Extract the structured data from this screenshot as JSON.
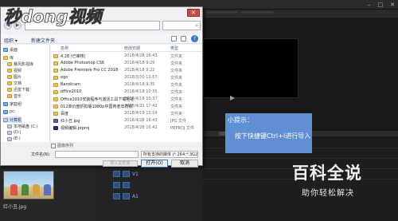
{
  "watermark_left": {
    "text": "秒dong视频"
  },
  "watermark_right": {
    "title": "百科全说",
    "subtitle": "助你轻松解决"
  },
  "tooltip": {
    "title": "小提示：",
    "text": "按下快捷键Ctrl+I进行导入"
  },
  "dialog": {
    "toolbar": {
      "organize": "组织 ▾",
      "new_folder": "新建文件夹",
      "help": "?"
    },
    "close": "✕",
    "nav": [
      {
        "label": "桌面"
      },
      {
        "label": "库"
      },
      {
        "label": "暴风影视库"
      },
      {
        "label": "视频"
      },
      {
        "label": "图片"
      },
      {
        "label": "文档"
      },
      {
        "label": "迅雷下载"
      },
      {
        "label": "音乐"
      },
      {
        "label": "家庭组"
      },
      {
        "label": "pc"
      },
      {
        "label": "计算机"
      },
      {
        "label": "本地磁盘 (C:)"
      },
      {
        "label": "(D:)"
      },
      {
        "label": "(E:)"
      }
    ],
    "columns": {
      "name": "名称",
      "date": "修改日期",
      "type": "类型"
    },
    "files": [
      {
        "name": "4.28 (已审核)",
        "date": "2018/4/28 16:43",
        "type": "文件夹",
        "icon": "folder-icon"
      },
      {
        "name": "Adobe Photoshop CS6",
        "date": "2018/4/18 9:29",
        "type": "文件夹",
        "icon": "folder-icon"
      },
      {
        "name": "Adobe Premiere Pro CC 2018",
        "date": "2018/4/18 9:22",
        "type": "文件夹",
        "icon": "folder-icon"
      },
      {
        "name": "ego",
        "date": "2018/3/30 13:57",
        "type": "文件夹",
        "icon": "folder-icon"
      },
      {
        "name": "Bandicam",
        "date": "2018/4/18 9:35",
        "type": "文件夹",
        "icon": "folder-icon"
      },
      {
        "name": "office2010",
        "date": "2018/4/18 10:35",
        "type": "文件夹",
        "icon": "folder-icon"
      },
      {
        "name": "Office2010安装程序与激活工具下载地址",
        "date": "2018/4/18 10:37",
        "type": "文件夹",
        "icon": "folder-icon"
      },
      {
        "name": "012单价盘折扣版1080p中国男老年奇航",
        "date": "2018/4/21 17:42",
        "type": "文件夹",
        "icon": "folder-icon"
      },
      {
        "name": "百度",
        "date": "2018/4/19 15:54",
        "type": "文件夹",
        "icon": "folder-icon"
      },
      {
        "name": "红小丑.jpg",
        "date": "2018/4/28 16:43",
        "type": "JPG 文件",
        "icon": "video-file-icon"
      },
      {
        "name": "视频编辑.prproj",
        "date": "2018/4/28 16:42",
        "type": "PRPROJ 文件",
        "icon": "project-file-icon"
      }
    ],
    "sequence_checkbox": "图像序列",
    "filename_label": "文件名(N):",
    "filename_value": "",
    "filetype_value": "所有支持的媒体 (*.264;*.3G2;*",
    "import_folder_button": "导入文件夹",
    "open_button": "打开(O)",
    "cancel_button": "取消"
  },
  "project_panel": {
    "thumbnail_label": "红小丑.jpg"
  },
  "track_labels": [
    "V1",
    "A1"
  ]
}
